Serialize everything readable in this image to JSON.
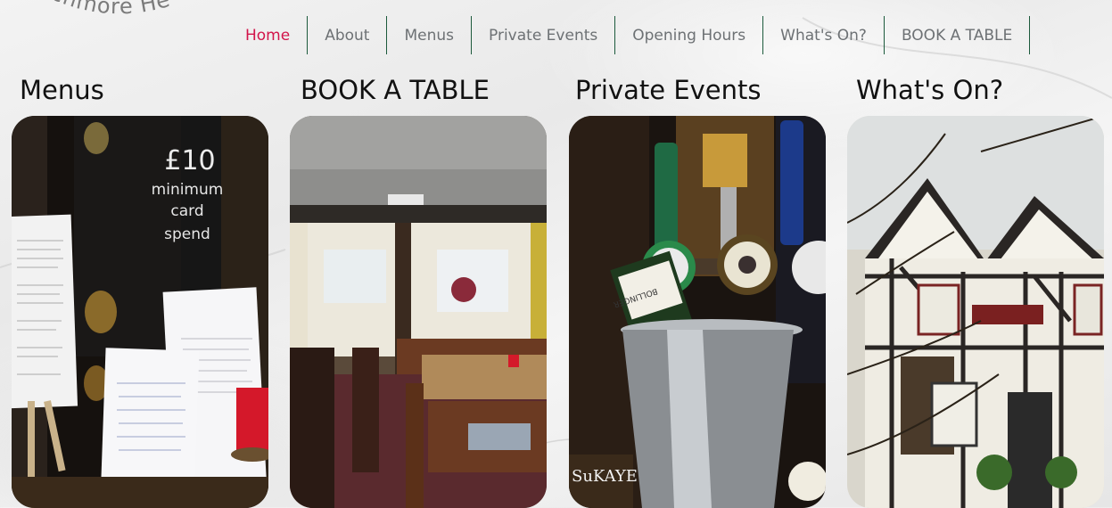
{
  "logo": {
    "arc_text": "chmore He"
  },
  "nav": {
    "items": [
      {
        "label": "Home",
        "active": true
      },
      {
        "label": "About"
      },
      {
        "label": "Menus"
      },
      {
        "label": "Private Events"
      },
      {
        "label": "Opening Hours"
      },
      {
        "label": "What's On?"
      },
      {
        "label": "BOOK A TABLE"
      }
    ],
    "active_color": "#d2144a",
    "text_color": "#6d7174",
    "divider_color": "#1c5a3c"
  },
  "sections": [
    {
      "heading": "Menus",
      "image_desc": "chalkboard-and-menu-cards",
      "chalkboard": [
        "£10",
        "minimum",
        "card",
        "spend"
      ]
    },
    {
      "heading": "BOOK A TABLE",
      "image_desc": "pub-dining-room"
    },
    {
      "heading": "Private Events",
      "image_desc": "champagne-bucket-at-bar",
      "bottle_label": "BOLLINGER",
      "watermark": "SuKAYE"
    },
    {
      "heading": "What's On?",
      "image_desc": "tudor-style-pub-exterior"
    }
  ]
}
